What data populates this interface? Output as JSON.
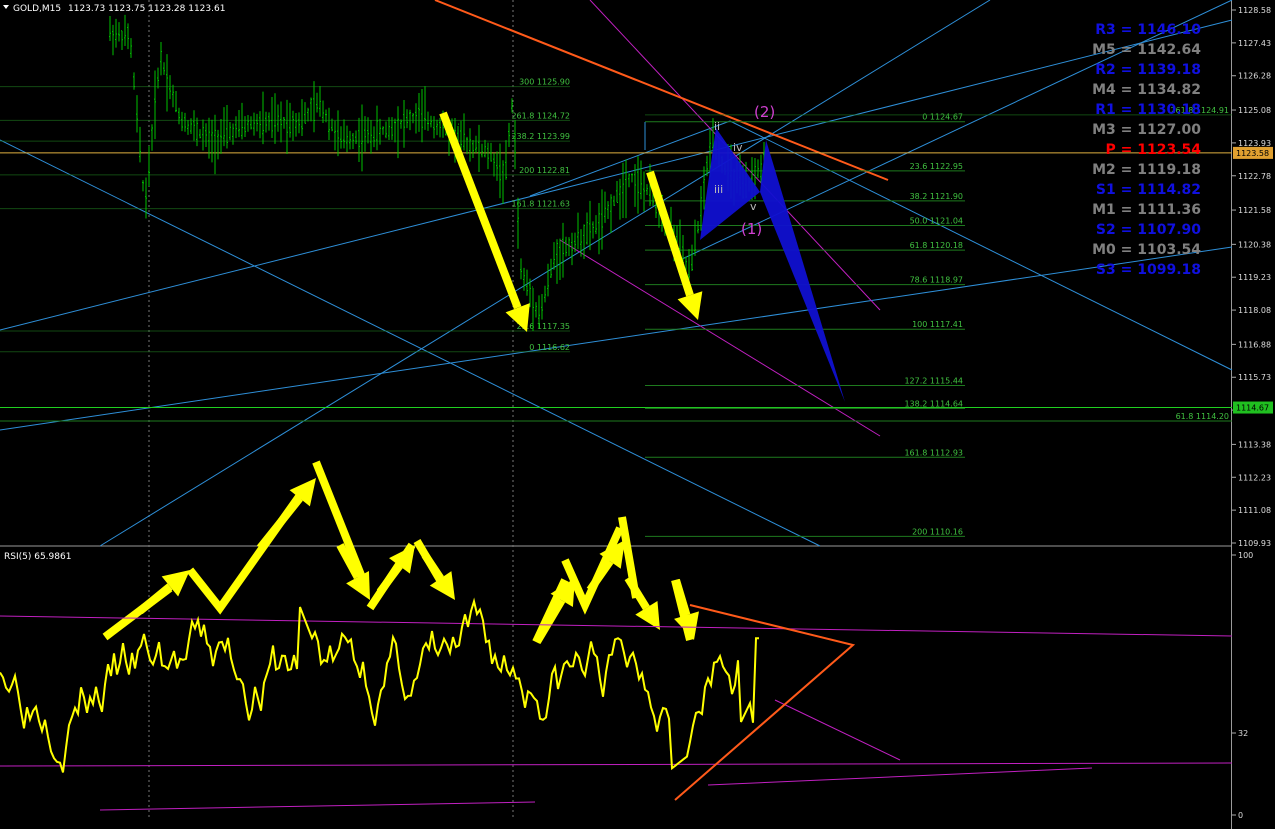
{
  "window": {
    "symbol_label": "GOLD,M15",
    "ohlc": "1123.73 1123.75 1123.28 1123.61"
  },
  "rsi_label": "RSI(5) 65.9861",
  "colors": {
    "background": "#000000",
    "candles": "#00c000",
    "rsi_line": "#ffff00",
    "arrows": "#ffff00",
    "pivot_r": "#1010e0",
    "pivot_m": "#808080",
    "pivot_p": "#ff0000",
    "fib": "#1e7a1e",
    "channel": "#2e8fd8",
    "magenta": "#c020c0",
    "orange": "#ff5a1a",
    "pattern": "#1010d0"
  },
  "price_axis": {
    "ticks": [
      "1128.58",
      "1127.43",
      "1126.28",
      "1125.08",
      "1123.93",
      "1122.78",
      "1121.58",
      "1120.38",
      "1119.23",
      "1118.08",
      "1116.88",
      "1115.73",
      "1114.58",
      "1113.38",
      "1112.23",
      "1111.08",
      "1109.93"
    ],
    "current_price_tag": "1123.58",
    "level_price_tag": "1114.67"
  },
  "rsi_axis": {
    "ticks": [
      "100",
      "32",
      "0"
    ]
  },
  "pivots": [
    {
      "label": "R3 = 1146.10",
      "kind": "r"
    },
    {
      "label": "M5 = 1142.64",
      "kind": "m"
    },
    {
      "label": "R2 = 1139.18",
      "kind": "r"
    },
    {
      "label": "M4 = 1134.82",
      "kind": "m"
    },
    {
      "label": "R1 = 1130.18",
      "kind": "r"
    },
    {
      "label": "M3 = 1127.00",
      "kind": "m"
    },
    {
      "label": "P = 1123.54",
      "kind": "p"
    },
    {
      "label": "M2 = 1119.18",
      "kind": "m"
    },
    {
      "label": "S1 = 1114.82",
      "kind": "r"
    },
    {
      "label": "M1 = 1111.36",
      "kind": "m"
    },
    {
      "label": "S2 = 1107.90",
      "kind": "r"
    },
    {
      "label": "M0 = 1103.54",
      "kind": "m"
    },
    {
      "label": "S3 = 1099.18",
      "kind": "r"
    }
  ],
  "fib_right": [
    {
      "label": "0 1124.67",
      "price": 1124.67
    },
    {
      "label": "23.6 1122.95",
      "price": 1122.95
    },
    {
      "label": "38.2 1121.90",
      "price": 1121.9
    },
    {
      "label": "50.0 1121.04",
      "price": 1121.04
    },
    {
      "label": "61.8 1120.18",
      "price": 1120.18
    },
    {
      "label": "78.6 1118.97",
      "price": 1118.97
    },
    {
      "label": "100 1117.41",
      "price": 1117.41
    },
    {
      "label": "127.2 1115.44",
      "price": 1115.44
    },
    {
      "label": "138.2 1114.64",
      "price": 1114.64
    },
    {
      "label": "161.8 1112.93",
      "price": 1112.93
    },
    {
      "label": "200 1110.16",
      "price": 1110.16
    }
  ],
  "fib_left": [
    {
      "label": "300 1125.90",
      "price": 1125.9
    },
    {
      "label": "261.8 1124.72",
      "price": 1124.72
    },
    {
      "label": "238.2 1123.99",
      "price": 1123.99
    },
    {
      "label": "200 1122.81",
      "price": 1122.81
    },
    {
      "label": "161.8 1121.63",
      "price": 1121.63
    },
    {
      "label": "23.6 1117.35",
      "price": 1117.35
    },
    {
      "label": "0 1116.62",
      "price": 1116.62
    }
  ],
  "fib_far": {
    "label": "61.8 1114.20",
    "price": 1114.2
  },
  "fib_far_top": {
    "label": "261.8 1124.91",
    "price": 1124.91
  },
  "wave_labels": [
    "(2)",
    "(1)",
    "iv",
    "iii",
    "v",
    "ii"
  ],
  "chart_data": {
    "type": "line",
    "title": "GOLD,M15",
    "price_range": [
      1109.93,
      1128.58
    ],
    "rsi_range": [
      0,
      100
    ],
    "series": [
      {
        "name": "RSI(5)",
        "last": 65.9861
      }
    ],
    "pivot_levels": [
      1146.1,
      1142.64,
      1139.18,
      1134.82,
      1130.18,
      1127.0,
      1123.54,
      1119.18,
      1114.82,
      1111.36,
      1107.9,
      1103.54,
      1099.18
    ],
    "current_price": 1123.58,
    "marked_level": 1114.67
  }
}
